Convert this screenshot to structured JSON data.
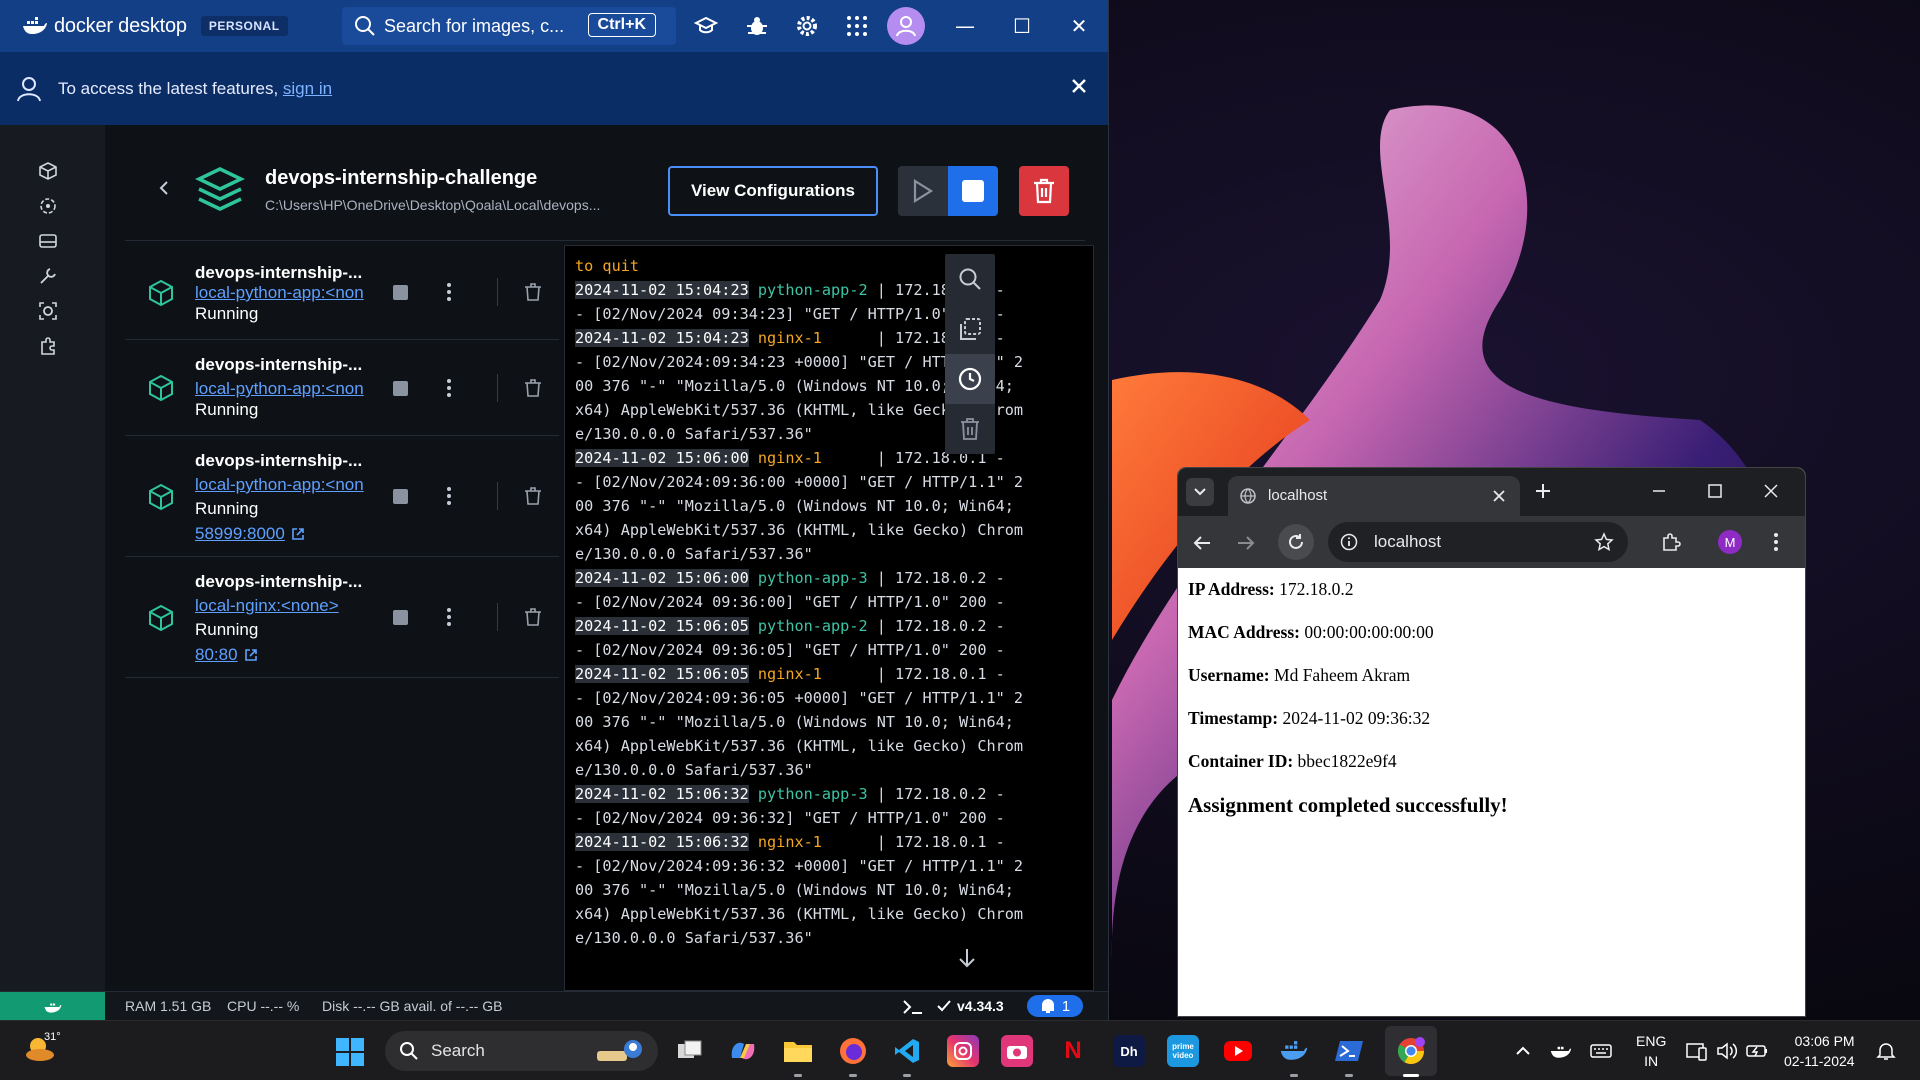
{
  "docker": {
    "brand": "docker desktop",
    "plan_badge": "PERSONAL",
    "search_placeholder": "Search for images, c...",
    "search_shortcut": "Ctrl+K",
    "banner_text": "To access the latest features, ",
    "banner_link": "sign in",
    "project": {
      "title": "devops-internship-challenge",
      "path": "C:\\Users\\HP\\OneDrive\\Desktop\\Qoala\\Local\\devops...",
      "view_config_label": "View Configurations"
    },
    "containers": [
      {
        "name": "devops-internship-...",
        "image": "local-python-app:<non",
        "status": "Running",
        "port": ""
      },
      {
        "name": "devops-internship-...",
        "image": "local-python-app:<non",
        "status": "Running",
        "port": ""
      },
      {
        "name": "devops-internship-...",
        "image": "local-python-app:<non",
        "status": "Running",
        "port": "58999:8000"
      },
      {
        "name": "devops-internship-...",
        "image": "local-nginx:<none>",
        "status": "Running",
        "port": "80:80"
      }
    ],
    "logs": [
      {
        "kind": "quit",
        "text": "to quit"
      },
      {
        "kind": "entry",
        "ts": "2024-11-02 15:04:23",
        "svc": "python-app-2",
        "svc_type": "py",
        "body": " | 172.18.0.2 -\n- [02/Nov/2024 09:34:23] \"GET / HTTP/1.0\" 200 -"
      },
      {
        "kind": "entry",
        "ts": "2024-11-02 15:04:23",
        "svc": "nginx-1",
        "svc_type": "ng",
        "body": "      | 172.18.0.1 -\n- [02/Nov/2024:09:34:23 +0000] \"GET / HTTP/1.1\" 2\n00 376 \"-\" \"Mozilla/5.0 (Windows NT 10.0; Win64;\nx64) AppleWebKit/537.36 (KHTML, like Gecko) Chrom\ne/130.0.0.0 Safari/537.36\""
      },
      {
        "kind": "entry",
        "ts": "2024-11-02 15:06:00",
        "svc": "nginx-1",
        "svc_type": "ng",
        "body": "      | 172.18.0.1 -\n- [02/Nov/2024:09:36:00 +0000] \"GET / HTTP/1.1\" 2\n00 376 \"-\" \"Mozilla/5.0 (Windows NT 10.0; Win64;\nx64) AppleWebKit/537.36 (KHTML, like Gecko) Chrom\ne/130.0.0.0 Safari/537.36\""
      },
      {
        "kind": "entry",
        "ts": "2024-11-02 15:06:00",
        "svc": "python-app-3",
        "svc_type": "py",
        "body": " | 172.18.0.2 -\n- [02/Nov/2024 09:36:00] \"GET / HTTP/1.0\" 200 -"
      },
      {
        "kind": "entry",
        "ts": "2024-11-02 15:06:05",
        "svc": "python-app-2",
        "svc_type": "py",
        "body": " | 172.18.0.2 -\n- [02/Nov/2024 09:36:05] \"GET / HTTP/1.0\" 200 -"
      },
      {
        "kind": "entry",
        "ts": "2024-11-02 15:06:05",
        "svc": "nginx-1",
        "svc_type": "ng",
        "body": "      | 172.18.0.1 -\n- [02/Nov/2024:09:36:05 +0000] \"GET / HTTP/1.1\" 2\n00 376 \"-\" \"Mozilla/5.0 (Windows NT 10.0; Win64;\nx64) AppleWebKit/537.36 (KHTML, like Gecko) Chrom\ne/130.0.0.0 Safari/537.36\""
      },
      {
        "kind": "entry",
        "ts": "2024-11-02 15:06:32",
        "svc": "python-app-3",
        "svc_type": "py",
        "body": " | 172.18.0.2 -\n- [02/Nov/2024 09:36:32] \"GET / HTTP/1.0\" 200 -"
      },
      {
        "kind": "entry",
        "ts": "2024-11-02 15:06:32",
        "svc": "nginx-1",
        "svc_type": "ng",
        "body": "      | 172.18.0.1 -\n- [02/Nov/2024:09:36:32 +0000] \"GET / HTTP/1.1\" 2\n00 376 \"-\" \"Mozilla/5.0 (Windows NT 10.0; Win64;\nx64) AppleWebKit/537.36 (KHTML, like Gecko) Chrom\ne/130.0.0.0 Safari/537.36\""
      }
    ],
    "status": {
      "ram": "RAM 1.51 GB",
      "cpu": "CPU --.-- %",
      "disk": "Disk --.-- GB avail. of --.-- GB",
      "version": "v4.34.3",
      "notifications": "1"
    }
  },
  "chrome": {
    "tab_title": "localhost",
    "url": "localhost",
    "profile_initial": "M",
    "fields": [
      {
        "label": "IP Address:",
        "value": "172.18.0.2"
      },
      {
        "label": "MAC Address:",
        "value": "00:00:00:00:00:00"
      },
      {
        "label": "Username:",
        "value": "Md Faheem Akram"
      },
      {
        "label": "Timestamp:",
        "value": "2024-11-02 09:36:32"
      },
      {
        "label": "Container ID:",
        "value": "bbec1822e9f4"
      }
    ],
    "message": "Assignment completed successfully!"
  },
  "taskbar": {
    "weather_temp": "31°",
    "search_label": "Search",
    "lang_line1": "ENG",
    "lang_line2": "IN",
    "time": "03:06 PM",
    "date": "02-11-2024",
    "apps": [
      "task-view",
      "copilot",
      "file-explorer",
      "firefox",
      "vscode",
      "instagram",
      "app-store",
      "netflix",
      "hotstar",
      "prime-video",
      "youtube",
      "docker",
      "powershell",
      "chrome"
    ]
  },
  "colors": {
    "docker_titlebar": "#133f86",
    "docker_banner": "#0b2d66",
    "docker_accent": "#1f6feb",
    "delete_red": "#d9363e",
    "status_green": "#129b72",
    "log_python": "#3ec4a6",
    "log_nginx": "#f5a623"
  }
}
